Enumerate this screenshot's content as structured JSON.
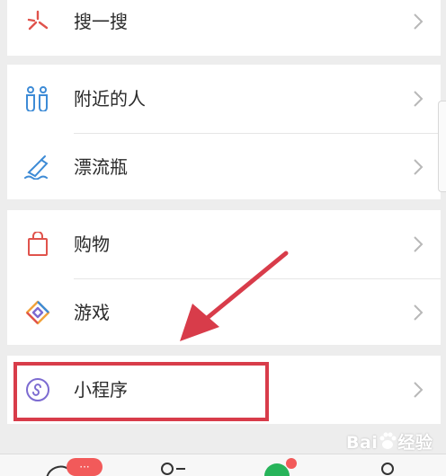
{
  "menu": {
    "items": [
      {
        "label": "搜一搜",
        "icon": "search-sparkle-icon",
        "color": "#e0534c"
      },
      {
        "label": "附近的人",
        "icon": "people-nearby-icon",
        "color": "#3d8bd6"
      },
      {
        "label": "漂流瓶",
        "icon": "drift-bottle-icon",
        "color": "#3d8bd6"
      },
      {
        "label": "购物",
        "icon": "shopping-bag-icon",
        "color": "#e0534c"
      },
      {
        "label": "游戏",
        "icon": "game-diamond-icon",
        "color": "#f2a33a"
      },
      {
        "label": "小程序",
        "icon": "mini-program-icon",
        "color": "#7c6bd1"
      }
    ]
  },
  "tabbar": {
    "chats_badge": "···"
  },
  "watermark": {
    "text": "Bai",
    "suffix": "经验"
  },
  "colors": {
    "highlight": "#d83c4a",
    "background": "#ededed"
  }
}
